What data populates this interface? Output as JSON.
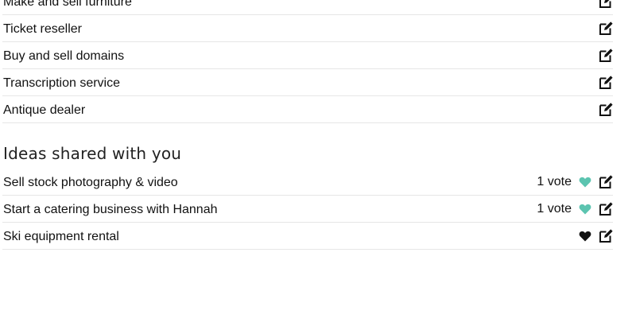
{
  "my_ideas": [
    {
      "title": "Make and sell furniture"
    },
    {
      "title": "Ticket reseller"
    },
    {
      "title": "Buy and sell domains"
    },
    {
      "title": "Transcription service"
    },
    {
      "title": "Antique dealer"
    }
  ],
  "shared_section": {
    "heading": "Ideas shared with you",
    "items": [
      {
        "title": "Sell stock photography & video",
        "votes": "1 vote",
        "heart_color": "#5cc4b0"
      },
      {
        "title": "Start a catering business with Hannah",
        "votes": "1 vote",
        "heart_color": "#5cc4b0"
      },
      {
        "title": "Ski equipment rental",
        "votes": "",
        "heart_color": "#111111"
      }
    ]
  },
  "icons": {
    "edit": "edit-icon",
    "heart": "heart-icon"
  }
}
